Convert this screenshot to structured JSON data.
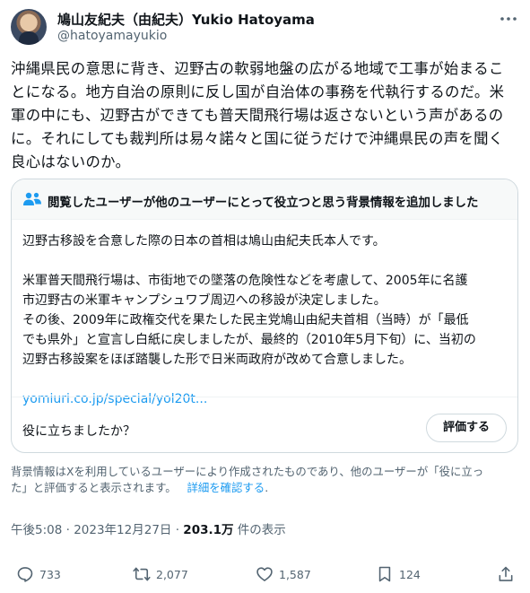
{
  "author": {
    "display_name": "鳩山友紀夫（由紀夫）Yukio Hatoyama",
    "handle": "@hatoyamayukio",
    "avatar_icon": "avatar"
  },
  "tweet": {
    "text": "沖縄県民の意思に背き、辺野古の軟弱地盤の広がる地域で工事が始まるこ\nとになる。地方自治の原則に反し国が自治体の事務を代執行するのだ。米\n軍の中にも、辺野古ができても普天間飛行場は返さないという声があるの\nに。それにしても裁判所は易々諾々と国に従うだけで沖縄県民の声を聞く\n良心はないのか。"
  },
  "community_note": {
    "title": "閲覧したユーザーが他のユーザーにとって役立つと思う背景情報を追加しました",
    "paragraph1": "辺野古移設を合意した際の日本の首相は鳩山由紀夫氏本人です。",
    "paragraph2": "米軍普天間飛行場は、市街地での墜落の危険性などを考慮して、2005年に名護\n市辺野古の米軍キャンプシュワブ周辺への移設が決定しました。\nその後、2009年に政権交代を果たした民主党鳩山由紀夫首相（当時）が「最低\nでも県外」と宣言し白紙に戻しましたが、最終的（2010年5月下旬）に、当初の\n辺野古移設案をほぼ踏襲した形で日米両政府が改めて合意しました。",
    "link": "yomiuri.co.jp/special/yol20t...",
    "helpful_question": "役に立ちましたか？",
    "rate_button": "評価する"
  },
  "disclaimer": {
    "text": "背景情報はXを利用しているユーザーにより作成されたものであり、他のユーザーが「役に立っ\nた」と評価すると表示されます。",
    "link": "詳細を確認する",
    "period": "."
  },
  "meta": {
    "time": "午後5:08",
    "sep1": " · ",
    "date": "2023年12月27日",
    "sep2": " · ",
    "views": "203.1万",
    "views_suffix": " 件の表示"
  },
  "actions": {
    "replies": "733",
    "reposts": "2,077",
    "likes": "1,587",
    "bookmarks": "124"
  },
  "colors": {
    "accent": "#1d9bf0",
    "secondary_text": "#536471",
    "border": "#cfd9de"
  }
}
